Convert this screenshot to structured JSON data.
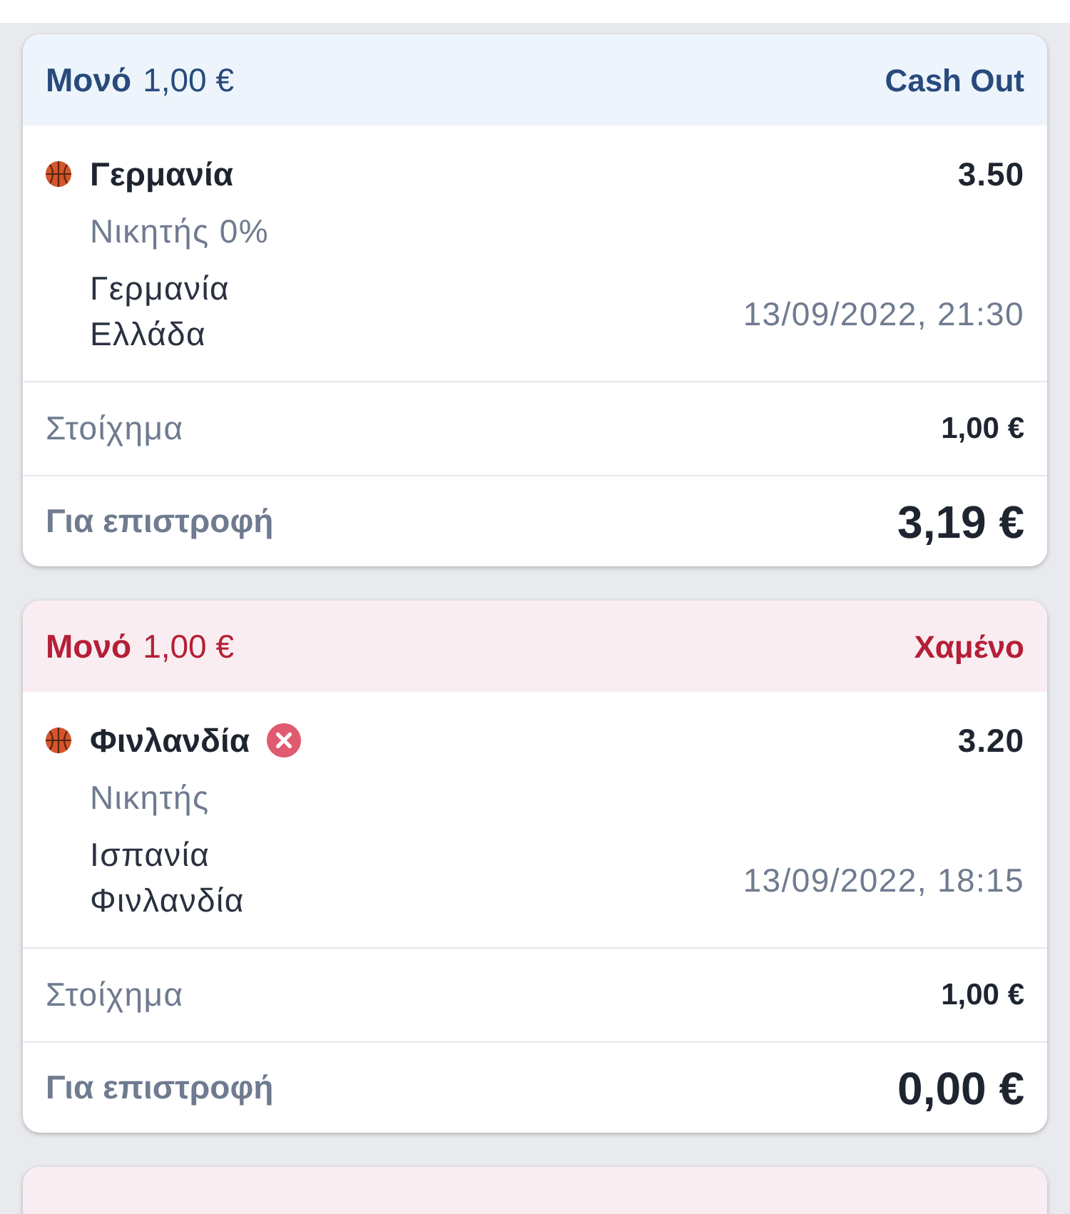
{
  "bets": [
    {
      "kind": "open",
      "type_label": "Μονό",
      "header_stake": "1,00 €",
      "status_label": "Cash Out",
      "selection": {
        "team": "Γερμανία",
        "lost": false,
        "odds": "3.50",
        "market": "Νικητής 0%",
        "home": "Γερμανία",
        "away": "Ελλάδα",
        "datetime": "13/09/2022, 21:30"
      },
      "stake_label": "Στοίχημα",
      "stake": "1,00 €",
      "return_label": "Για επιστροφή",
      "return": "3,19 €"
    },
    {
      "kind": "lost",
      "type_label": "Μονό",
      "header_stake": "1,00 €",
      "status_label": "Χαμένο",
      "selection": {
        "team": "Φινλανδία",
        "lost": true,
        "odds": "3.20",
        "market": "Νικητής",
        "home": "Ισπανία",
        "away": "Φινλανδία",
        "datetime": "13/09/2022, 18:15"
      },
      "stake_label": "Στοίχημα",
      "stake": "1,00 €",
      "return_label": "Για επιστροφή",
      "return": "0,00 €"
    },
    {
      "kind": "lost"
    }
  ]
}
